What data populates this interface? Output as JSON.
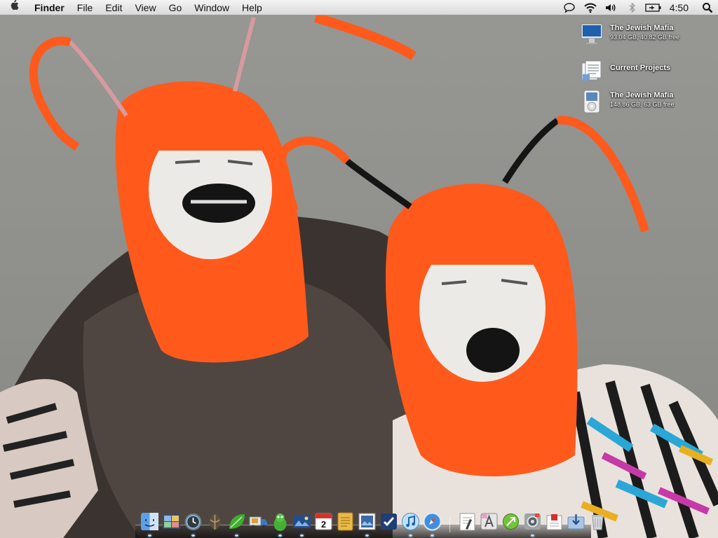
{
  "menubar": {
    "app_name": "Finder",
    "menus": [
      "File",
      "Edit",
      "View",
      "Go",
      "Window",
      "Help"
    ],
    "status_icons": [
      "chat-icon",
      "wifi-icon",
      "volume-icon",
      "bluetooth-icon",
      "battery-icon"
    ],
    "clock": "4:50",
    "spotlight_icon": "spotlight-icon"
  },
  "desktop": {
    "icons": [
      {
        "name": "The Jewish Mafia",
        "detail": "93.04 GB, 40.82 GB free",
        "icon": "imac-icon"
      },
      {
        "name": "Current Projects",
        "detail": "",
        "icon": "folder-docs-icon"
      },
      {
        "name": "The Jewish Mafia",
        "detail": "148.86 GB, 63 GB free",
        "icon": "ipod-icon"
      }
    ]
  },
  "dock": {
    "calendar_day": "2",
    "apps": [
      "finder",
      "dashboard",
      "time-machine",
      "quake",
      "leaf",
      "delivery-truck",
      "adium",
      "photo-browser",
      "ical",
      "notepad",
      "preview",
      "omnifocus",
      "itunes",
      "safari",
      "textedit",
      "app-store",
      "transmission",
      "system-preferences",
      "pdf-viewer",
      "downloads",
      "trash"
    ]
  },
  "colors": {
    "menubar_top": "#f4f4f4",
    "menubar_bottom": "#d9d9d9",
    "wig_orange": "#ff5a1c"
  }
}
